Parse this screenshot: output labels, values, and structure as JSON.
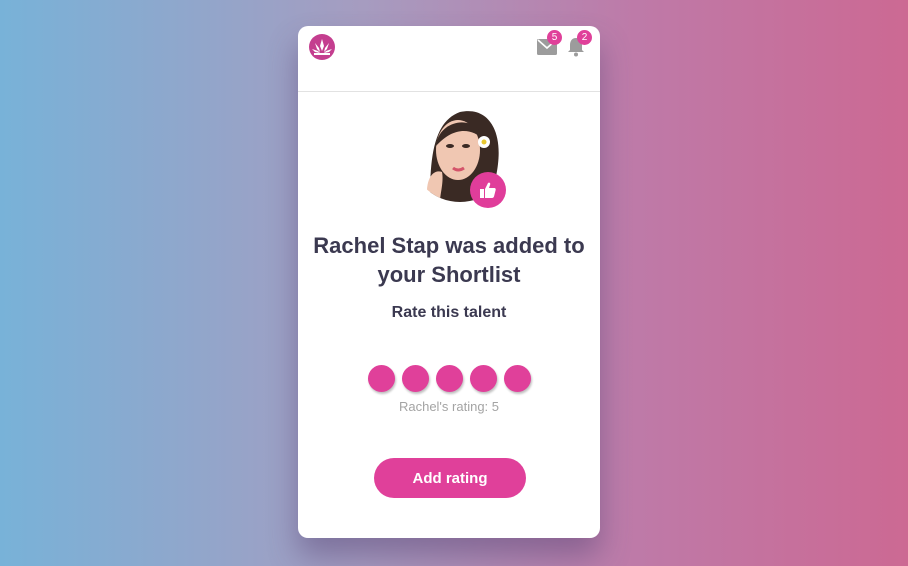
{
  "header": {
    "logo_icon": "lotus-logo-icon",
    "mail": {
      "icon": "mail-icon",
      "count": "5"
    },
    "notifications": {
      "icon": "bell-icon",
      "count": "2"
    }
  },
  "talent": {
    "name": "Rachel Stap",
    "avatar_icon": "talent-photo",
    "badge_icon": "thumbs-up-icon"
  },
  "headline": "Rachel Stap was added to your Shortlist",
  "subhead": "Rate this talent",
  "rating": {
    "max": 5,
    "value": 5,
    "label": "Rachel's rating: 5"
  },
  "actions": {
    "add_rating_label": "Add rating"
  },
  "colors": {
    "accent": "#e0409a",
    "heading": "#3b3950",
    "muted": "#a4a4a4",
    "icon_gray": "#9c9c9c"
  }
}
